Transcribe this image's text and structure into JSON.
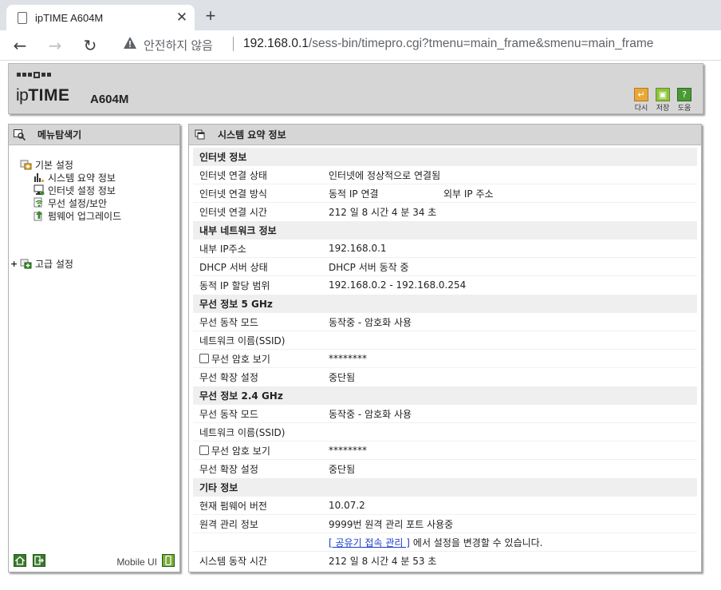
{
  "browser": {
    "tab_title": "ipTIME A604M",
    "tab_close": "✕",
    "new_tab": "+",
    "back": "←",
    "forward": "→",
    "reload": "↻",
    "security_status": "안전하지 않음",
    "url_host": "192.168.0.1",
    "url_path": "/sess-bin/timepro.cgi?tmenu=main_frame&smenu=main_frame"
  },
  "header": {
    "logo_ip": "ip",
    "logo_time": "TIME",
    "model": "A604M",
    "buttons": [
      {
        "label": "다시",
        "color": "#e8a838"
      },
      {
        "label": "저장",
        "color": "#8cc43c"
      },
      {
        "label": "도움",
        "color": "#4a9a34"
      }
    ]
  },
  "sidebar": {
    "title": "메뉴탐색기",
    "basic": {
      "label": "기본 설정",
      "children": [
        "시스템 요약 정보",
        "인터넷 설정 정보",
        "무선 설정/보안",
        "펌웨어 업그레이드"
      ]
    },
    "advanced": {
      "toggle": "+",
      "label": "고급 설정"
    },
    "mobile_ui": "Mobile UI"
  },
  "main": {
    "title": "시스템 요약 정보",
    "sections": {
      "internet": {
        "title": "인터넷 정보",
        "status_label": "인터넷 연결 상태",
        "status_value": "인터넷에 정상적으로 연결됨",
        "method_label": "인터넷 연결 방식",
        "method_value": "동적 IP 연결",
        "ext_ip_label": "외부 IP 주소",
        "time_label": "인터넷 연결 시간",
        "time_value": "212 일 8 시간 4 분 34 초"
      },
      "lan": {
        "title": "내부 네트워크 정보",
        "ip_label": "내부 IP주소",
        "ip_value": "192.168.0.1",
        "dhcp_label": "DHCP 서버 상태",
        "dhcp_value": "DHCP 서버 동작 중",
        "range_label": "동적 IP 할당 범위",
        "range_value": "192.168.0.2 -  192.168.0.254"
      },
      "wifi5": {
        "title": "무선 정보 5 GHz",
        "mode_label": "무선 동작 모드",
        "mode_value": "동작중 - 암호화 사용",
        "ssid_label": "네트워크 이름(SSID)",
        "ssid_value": "",
        "pw_label": "무선 암호 보기",
        "pw_value": "********",
        "ext_label": "무선 확장 설정",
        "ext_value": "중단됨"
      },
      "wifi24": {
        "title": "무선 정보 2.4 GHz",
        "mode_label": "무선 동작 모드",
        "mode_value": "동작중 - 암호화 사용",
        "ssid_label": "네트워크 이름(SSID)",
        "ssid_value": "",
        "pw_label": "무선 암호 보기",
        "pw_value": "********",
        "ext_label": "무선 확장 설정",
        "ext_value": "중단됨"
      },
      "etc": {
        "title": "기타 정보",
        "fw_label": "현재 펌웨어 버전",
        "fw_value": "10.07.2",
        "remote_label": "원격 관리 정보",
        "remote_value": "9999번 원격 관리 포트 사용중",
        "link_text": "[ 공유기 접속 관리 ]",
        "link_suffix": "에서 설정을 변경할 수 있습니다.",
        "uptime_label": "시스템 동작 시간",
        "uptime_value": "212 일 8 시간 4 분 53 초"
      }
    }
  }
}
